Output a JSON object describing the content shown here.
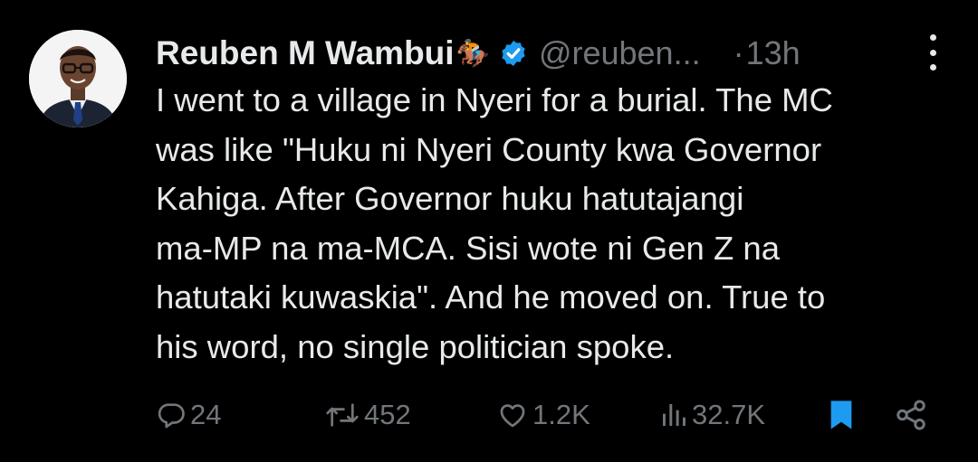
{
  "author": {
    "name": "Reuben M Wambui",
    "emoji": "🏇",
    "handle": "@reuben...",
    "separator": "·",
    "time": "13h"
  },
  "tweet": {
    "lines": [
      "I went to a village in Nyeri for a burial. The MC",
      "was like \"Huku ni Nyeri County kwa Governor",
      "Kahiga. After Governor huku hatutajangi",
      "ma-MP na ma-MCA. Sisi wote ni Gen Z na",
      "hatutaki kuwaskia\". And he moved on. True to",
      "his word, no single politician spoke."
    ]
  },
  "actions": {
    "replies": "24",
    "reposts": "452",
    "likes": "1.2K",
    "views": "32.7K"
  },
  "colors": {
    "background": "#000000",
    "text": "#e7e9ea",
    "muted": "#71767b",
    "accent": "#1d9bf0"
  },
  "icons": [
    "avatar",
    "verified-badge-icon",
    "more-icon",
    "reply-icon",
    "repost-icon",
    "like-icon",
    "views-icon",
    "bookmark-icon",
    "share-icon"
  ]
}
